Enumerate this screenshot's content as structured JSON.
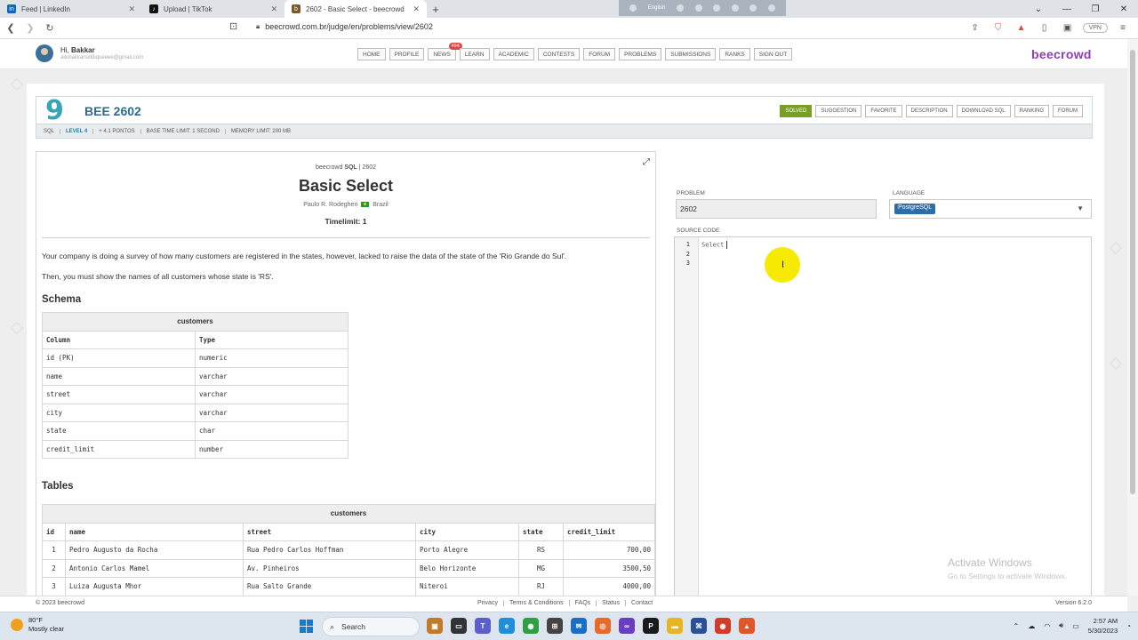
{
  "browser": {
    "tabs": [
      {
        "title": "Feed | LinkedIn",
        "icon": "linkedin-icon",
        "color": "#0a66c2",
        "glyph": "in"
      },
      {
        "title": "Upload | TikTok",
        "icon": "tiktok-icon",
        "color": "#111111",
        "glyph": "♪"
      },
      {
        "title": "2602 - Basic Select - beecrowd",
        "icon": "beecrowd-icon",
        "color": "#7a5a2a",
        "glyph": "b",
        "active": true
      }
    ],
    "new_tab": "+",
    "ime_label": "English",
    "url": "beecrowd.com.br/judge/en/problems/view/2602",
    "vpn": "VPN"
  },
  "site": {
    "user_greeting": "Hi,",
    "user_name": "Bakkar",
    "user_email": "allubakkarsiddiqueeee@gmail.com",
    "nav": [
      "HOME",
      "PROFILE",
      "NEWS",
      "LEARN",
      "ACADEMIC",
      "CONTESTS",
      "FORUM",
      "PROBLEMS",
      "SUBMISSIONS",
      "RANKS",
      "SIGN OUT"
    ],
    "news_badge": "494",
    "brand": "beecrowd"
  },
  "problem": {
    "code": "BEE 2602",
    "tabs": [
      "SOLVED",
      "SUGGESTION",
      "FAVORITE",
      "DESCRIPTION",
      "DOWNLOAD SQL",
      "RANKING",
      "FORUM"
    ],
    "meta": {
      "category": "SQL",
      "level": "LEVEL 4",
      "points": "+ 4.1 PONTOS",
      "time_limit": "BASE TIME LIMIT: 1 SECOND",
      "memory_limit": "MEMORY LIMIT: 200 MB"
    },
    "source_prefix": "beecrowd",
    "source_strong": "SQL",
    "source_suffix": "| 2602",
    "title": "Basic Select",
    "author": "Paulo R. Rodegheri",
    "country": "Brazil",
    "timelimit": "Timelimit: 1",
    "paragraph1": "Your company is doing a survey of how many customers are registered in the states, however, lacked to raise the data of the state of the 'Rio Grande do Sul'.",
    "paragraph2": "Then, you must show the names of all customers whose state is 'RS'.",
    "schema_heading": "Schema",
    "schema": {
      "caption": "customers",
      "headers": [
        "Column",
        "Type"
      ],
      "rows": [
        [
          "id (PK)",
          "numeric"
        ],
        [
          "name",
          "varchar"
        ],
        [
          "street",
          "varchar"
        ],
        [
          "city",
          "varchar"
        ],
        [
          "state",
          "char"
        ],
        [
          "credit_limit",
          "number"
        ]
      ]
    },
    "tables_heading": "Tables",
    "table": {
      "caption": "customers",
      "headers": [
        "id",
        "name",
        "street",
        "city",
        "state",
        "credit_limit"
      ],
      "rows": [
        [
          "1",
          "Pedro Augusto da Rocha",
          "Rua Pedro Carlos Hoffman",
          "Porto Alegre",
          "RS",
          "700,00"
        ],
        [
          "2",
          "Antonio Carlos Mamel",
          "Av. Pinheiros",
          "Belo Horizonte",
          "MG",
          "3500,50"
        ],
        [
          "3",
          "Luiza Augusta Mhor",
          "Rua Salto Grande",
          "Niteroi",
          "RJ",
          "4000,00"
        ]
      ]
    }
  },
  "editor": {
    "problem_label": "PROBLEM",
    "problem_value": "2602",
    "language_label": "LANGUAGE",
    "language_value": "PostgreSQL",
    "source_label": "SOURCE CODE",
    "line_numbers": [
      "1",
      "2",
      "3"
    ],
    "code_line1": "Select"
  },
  "watermark": {
    "line1": "Activate Windows",
    "line2": "Go to Settings to activate Windows."
  },
  "footer": {
    "copyright": "© 2023 beecrowd",
    "links": [
      "Privacy",
      "Terms & Conditions",
      "FAQs",
      "Status",
      "Contact"
    ],
    "version": "Version 6.2.0"
  },
  "taskbar": {
    "weather_temp": "80°F",
    "weather_desc": "Mostly clear",
    "weather_badge": "1",
    "search": "Search",
    "time": "2:57 AM",
    "date": "5/30/2023"
  }
}
